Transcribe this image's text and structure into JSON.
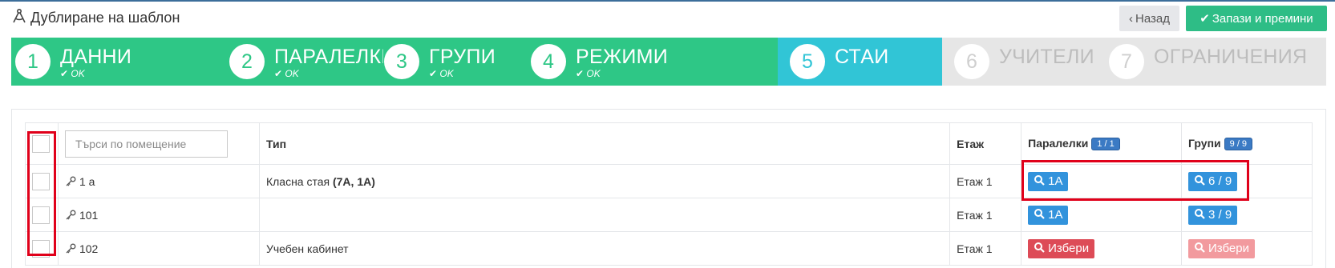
{
  "header": {
    "title": "Дублиране на шаблон",
    "back_label": "Назад",
    "save_label": "Запази и премини"
  },
  "colors": {
    "done": "#2ec786",
    "active": "#31c5d6",
    "todo": "#e6e6e6",
    "primary_button": "#2ebd86",
    "search_button": "#3293dc",
    "pick_button": "#dd4b57",
    "highlight": "#e0001a"
  },
  "wizard": {
    "steps": [
      {
        "num": "1",
        "title": "ДАННИ",
        "status": "OK"
      },
      {
        "num": "2",
        "title": "ПАРАЛЕЛКИ",
        "status": "OK"
      },
      {
        "num": "3",
        "title": "ГРУПИ",
        "status": "OK"
      },
      {
        "num": "4",
        "title": "РЕЖИМИ",
        "status": "OK"
      },
      {
        "num": "5",
        "title": "СТАИ"
      },
      {
        "num": "6",
        "title": "УЧИТЕЛИ"
      },
      {
        "num": "7",
        "title": "ОГРАНИЧЕНИЯ"
      }
    ]
  },
  "table": {
    "search_placeholder": "Търси по помещение",
    "headers": {
      "type": "Тип",
      "floor": "Етаж",
      "classes": "Паралелки",
      "classes_badge": "1 / 1",
      "groups": "Групи",
      "groups_badge": "9 / 9"
    },
    "rows": [
      {
        "room": "1 а",
        "type": "Класна стая",
        "type_bold": "(7А, 1А)",
        "floor": "Етаж 1",
        "classes": "1А",
        "groups": "6 / 9"
      },
      {
        "room": "101",
        "type": "",
        "type_bold": "",
        "floor": "Етаж 1",
        "classes": "1А",
        "groups": "3 / 9"
      },
      {
        "room": "102",
        "type": "Учебен кабинет",
        "type_bold": "",
        "floor": "Етаж 1",
        "classes": "Избери",
        "groups": "Избери"
      }
    ]
  }
}
